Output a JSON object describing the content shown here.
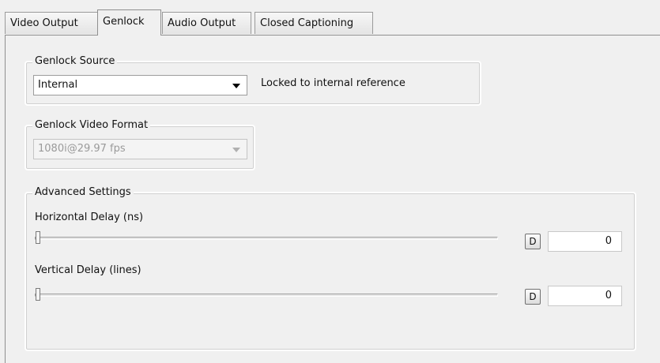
{
  "tabs": [
    {
      "label": "Video Output",
      "active": false
    },
    {
      "label": "Genlock",
      "active": true
    },
    {
      "label": "Audio Output",
      "active": false
    },
    {
      "label": "Closed Captioning",
      "active": false
    }
  ],
  "genlock_source": {
    "title": "Genlock Source",
    "selected": "Internal",
    "status": "Locked to internal reference"
  },
  "genlock_format": {
    "title": "Genlock Video Format",
    "selected": "1080i@29.97 fps",
    "enabled": false
  },
  "advanced": {
    "title": "Advanced Settings",
    "horizontal": {
      "label": "Horizontal Delay (ns)",
      "button": "D",
      "value": "0",
      "slider_position": 0
    },
    "vertical": {
      "label": "Vertical Delay (lines)",
      "button": "D",
      "value": "0",
      "slider_position": 0
    }
  }
}
